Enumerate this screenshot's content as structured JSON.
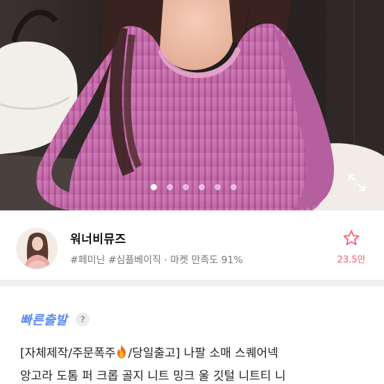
{
  "gallery": {
    "image_label": "pink ribbed angora square-neck crop knit",
    "page_count": 6,
    "active_index": 0,
    "colors": {
      "knit": "#c86fae",
      "knit_shadow": "#a25190",
      "background": "#2a2524"
    }
  },
  "icons": {
    "expand": "expand-arrows-icon",
    "favorite": "star-outline-icon",
    "help": "question-mark-icon",
    "fire": "fire-emoji-icon"
  },
  "seller": {
    "name": "워너비뮤즈",
    "tags": "#페미닌 #심플베이직 · 마켓 만족도 91%",
    "favorite_count": "23.5만"
  },
  "shipping": {
    "label": "빠른출발",
    "help_glyph": "?"
  },
  "product": {
    "title_part1": "[자체제작/주문폭주",
    "title_part2": "/당일출고] 나팔 소매 스퀘어넥",
    "title_line2": "앙고라 도톰 퍼 크롭 골지 니트 밍크 울 깃털 니트티 니"
  },
  "colors": {
    "accent_pink": "#ff5a72",
    "fast_blue": "#5a8cf2",
    "muted_text": "#777777"
  }
}
